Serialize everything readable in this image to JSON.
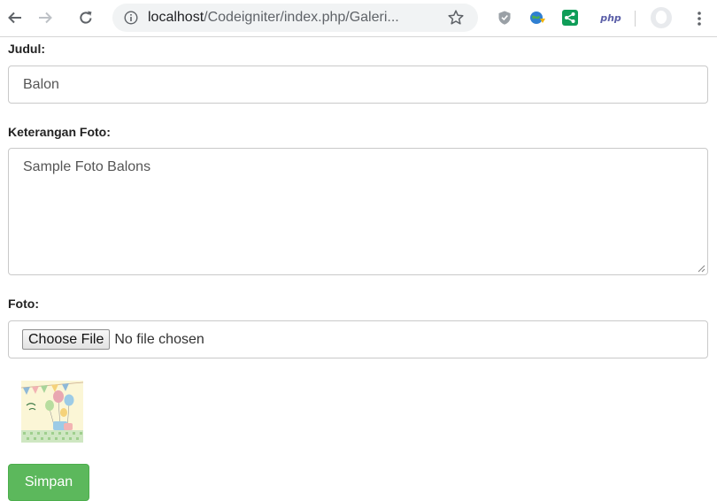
{
  "browser": {
    "url_host": "localhost",
    "url_path": "/Codeigniter/index.php/Galeri...",
    "extensions": {
      "php_label": "php"
    }
  },
  "form": {
    "judul": {
      "label": "Judul:",
      "value": "Balon"
    },
    "keterangan": {
      "label": "Keterangan Foto:",
      "value": "Sample Foto Balons"
    },
    "foto": {
      "label": "Foto:",
      "choose_label": "Choose File",
      "status": "No file chosen"
    },
    "submit_label": "Simpan"
  },
  "colors": {
    "submit_bg": "#5cb85c",
    "ext_share": "#0f9d58",
    "ext_php": "#5b5fa8"
  }
}
